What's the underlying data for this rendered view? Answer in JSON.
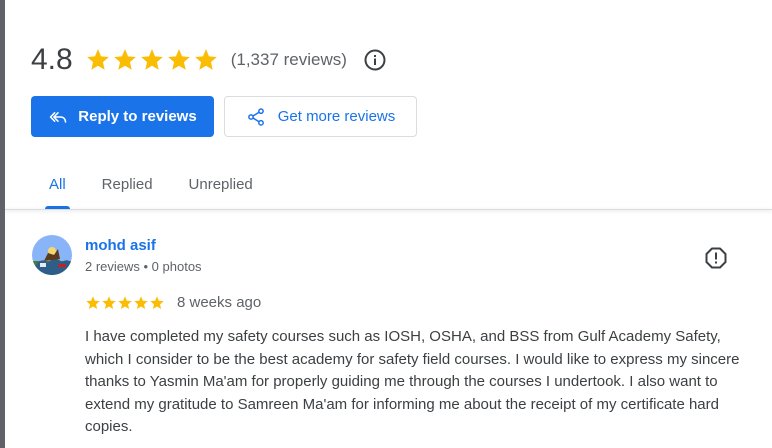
{
  "summary": {
    "rating": "4.8",
    "star_count": 5,
    "review_count": "(1,337 reviews)",
    "info_icon": "info-icon"
  },
  "actions": {
    "reply_label": "Reply to reviews",
    "reply_icon": "reply-all-icon",
    "more_label": "Get more reviews",
    "more_icon": "share-icon"
  },
  "tabs": [
    {
      "label": "All",
      "active": true
    },
    {
      "label": "Replied",
      "active": false
    },
    {
      "label": "Unreplied",
      "active": false
    }
  ],
  "reviews": [
    {
      "name": "mohd asif",
      "meta": "2 reviews • 0 photos",
      "stars": 5,
      "date": "8 weeks ago",
      "text": "I have completed my safety courses such as IOSH, OSHA, and BSS from Gulf Academy Safety, which I consider to be the best academy for safety field courses. I would like to express my sincere thanks to Yasmin Ma'am for properly guiding me through the courses I undertook. I also want to extend my gratitude to Samreen Ma'am for informing me about the receipt of my certificate hard copies."
    }
  ],
  "colors": {
    "accent": "#1a73e8",
    "star": "#fbbc04",
    "text": "#3c4043",
    "secondary_text": "#5f6368"
  }
}
